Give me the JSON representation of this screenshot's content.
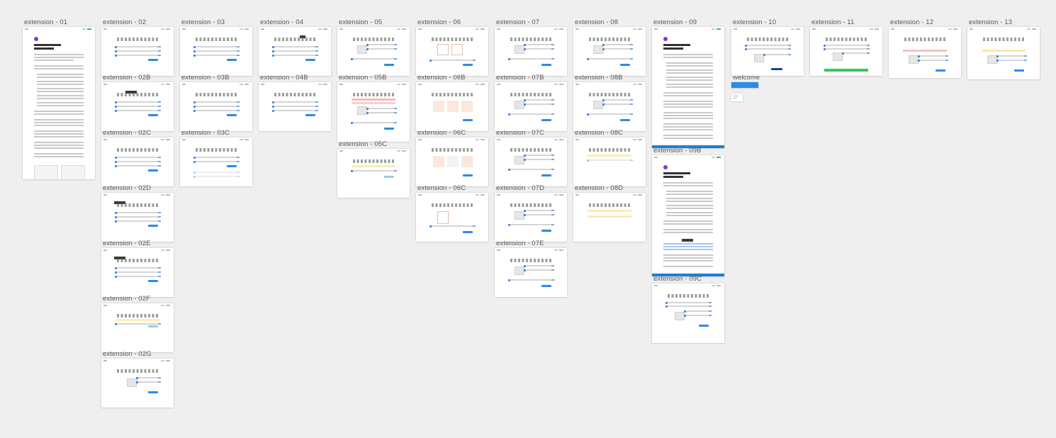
{
  "canvas": {
    "background": "#efefef",
    "accent": "#2a8be8"
  },
  "frames": [
    {
      "id": "f01",
      "label": "extension - 01",
      "kind": "doc-long"
    },
    {
      "id": "f02",
      "label": "extension - 02",
      "kind": "list"
    },
    {
      "id": "f02b",
      "label": "extension - 02B",
      "kind": "list-tip"
    },
    {
      "id": "f02c",
      "label": "extension - 02C",
      "kind": "list"
    },
    {
      "id": "f02d",
      "label": "extension - 02D",
      "kind": "list-tip"
    },
    {
      "id": "f02e",
      "label": "extension - 02E",
      "kind": "list-tip"
    },
    {
      "id": "f02f",
      "label": "extension - 02F",
      "kind": "list-yellow"
    },
    {
      "id": "f02g",
      "label": "extension - 02G",
      "kind": "list-image"
    },
    {
      "id": "f03",
      "label": "extension - 03",
      "kind": "list"
    },
    {
      "id": "f03b",
      "label": "extension - 03B",
      "kind": "list"
    },
    {
      "id": "f03c",
      "label": "extension - 03C",
      "kind": "list-faded"
    },
    {
      "id": "f04",
      "label": "extension - 04",
      "kind": "list-tip"
    },
    {
      "id": "f04b",
      "label": "extension - 04B",
      "kind": "list"
    },
    {
      "id": "f05",
      "label": "extension - 05",
      "kind": "list-image"
    },
    {
      "id": "f05b",
      "label": "extension - 05B",
      "kind": "list-red"
    },
    {
      "id": "f05c",
      "label": "extension - 05C",
      "kind": "list-yellow"
    },
    {
      "id": "f06",
      "label": "extension - 06",
      "kind": "list-diagram"
    },
    {
      "id": "f06b",
      "label": "extension - 06B",
      "kind": "list-diagram"
    },
    {
      "id": "f06c",
      "label": "extension - 06C",
      "kind": "list-diagram"
    },
    {
      "id": "f06d",
      "label": "extension - 06C",
      "kind": "list-diagram"
    },
    {
      "id": "f07",
      "label": "extension - 07",
      "kind": "list-image"
    },
    {
      "id": "f07b",
      "label": "extension - 07B",
      "kind": "list-image"
    },
    {
      "id": "f07c",
      "label": "extension - 07C",
      "kind": "list-image"
    },
    {
      "id": "f07d",
      "label": "extension - 07D",
      "kind": "list-image"
    },
    {
      "id": "f07e",
      "label": "extension - 07E",
      "kind": "list-image"
    },
    {
      "id": "f08",
      "label": "extension - 08",
      "kind": "list-image"
    },
    {
      "id": "f08b",
      "label": "extension - 08B",
      "kind": "list-image"
    },
    {
      "id": "f08c",
      "label": "extension - 08C",
      "kind": "list-yellow"
    },
    {
      "id": "f08d",
      "label": "extension - 08D",
      "kind": "list-yellow"
    },
    {
      "id": "f09",
      "label": "extension - 09",
      "kind": "doc-blue"
    },
    {
      "id": "f09b",
      "label": "extension - 09B",
      "kind": "doc-blue"
    },
    {
      "id": "f09c",
      "label": "extension - 09C",
      "kind": "list-image"
    },
    {
      "id": "f10",
      "label": "extension - 10",
      "kind": "list-image"
    },
    {
      "id": "fwelcome",
      "label": "welcome",
      "kind": "welcome"
    },
    {
      "id": "f11",
      "label": "extension - 11",
      "kind": "list-green"
    },
    {
      "id": "f12",
      "label": "extension - 12",
      "kind": "list-red"
    },
    {
      "id": "f13",
      "label": "extension - 13",
      "kind": "list-yellow"
    }
  ]
}
